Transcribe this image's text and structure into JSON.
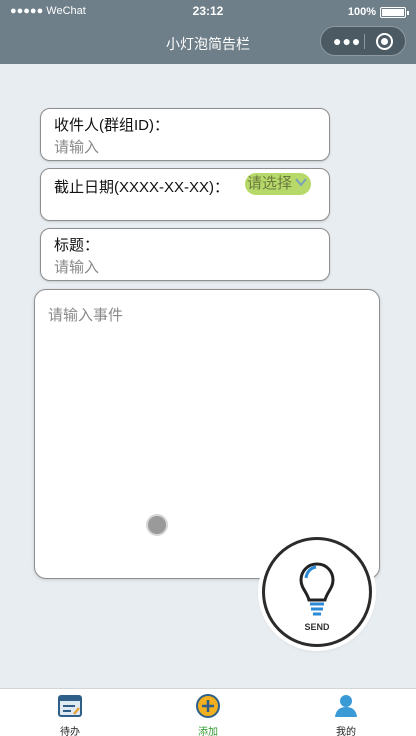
{
  "status_bar": {
    "signal": "●●●●● WeChat",
    "time": "23:12",
    "battery": "100%"
  },
  "nav": {
    "title": "小灯泡简告栏",
    "more_icon": "more-dots-icon",
    "close_icon": "target-circle-icon"
  },
  "form": {
    "recipient": {
      "label": "收件人(群组ID)：",
      "placeholder": "请输入"
    },
    "deadline": {
      "label": "截止日期(XXXX-XX-XX)：",
      "picker": "请选择"
    },
    "title": {
      "label": "标题：",
      "placeholder": "请输入"
    },
    "event": {
      "placeholder": "请输入事件"
    }
  },
  "send_button": {
    "label": "SEND",
    "icon": "lightbulb-icon"
  },
  "tabbar": {
    "items": [
      {
        "label": "待办",
        "icon": "todo-icon",
        "active": false
      },
      {
        "label": "添加",
        "icon": "add-circle-icon",
        "active": true
      },
      {
        "label": "我的",
        "icon": "user-icon",
        "active": false
      }
    ]
  },
  "colors": {
    "nav_bg": "#6f7f8a",
    "page_bg": "#e8edf1",
    "picker_bg": "#b7d96a",
    "active_tab": "#2e9a2e"
  }
}
